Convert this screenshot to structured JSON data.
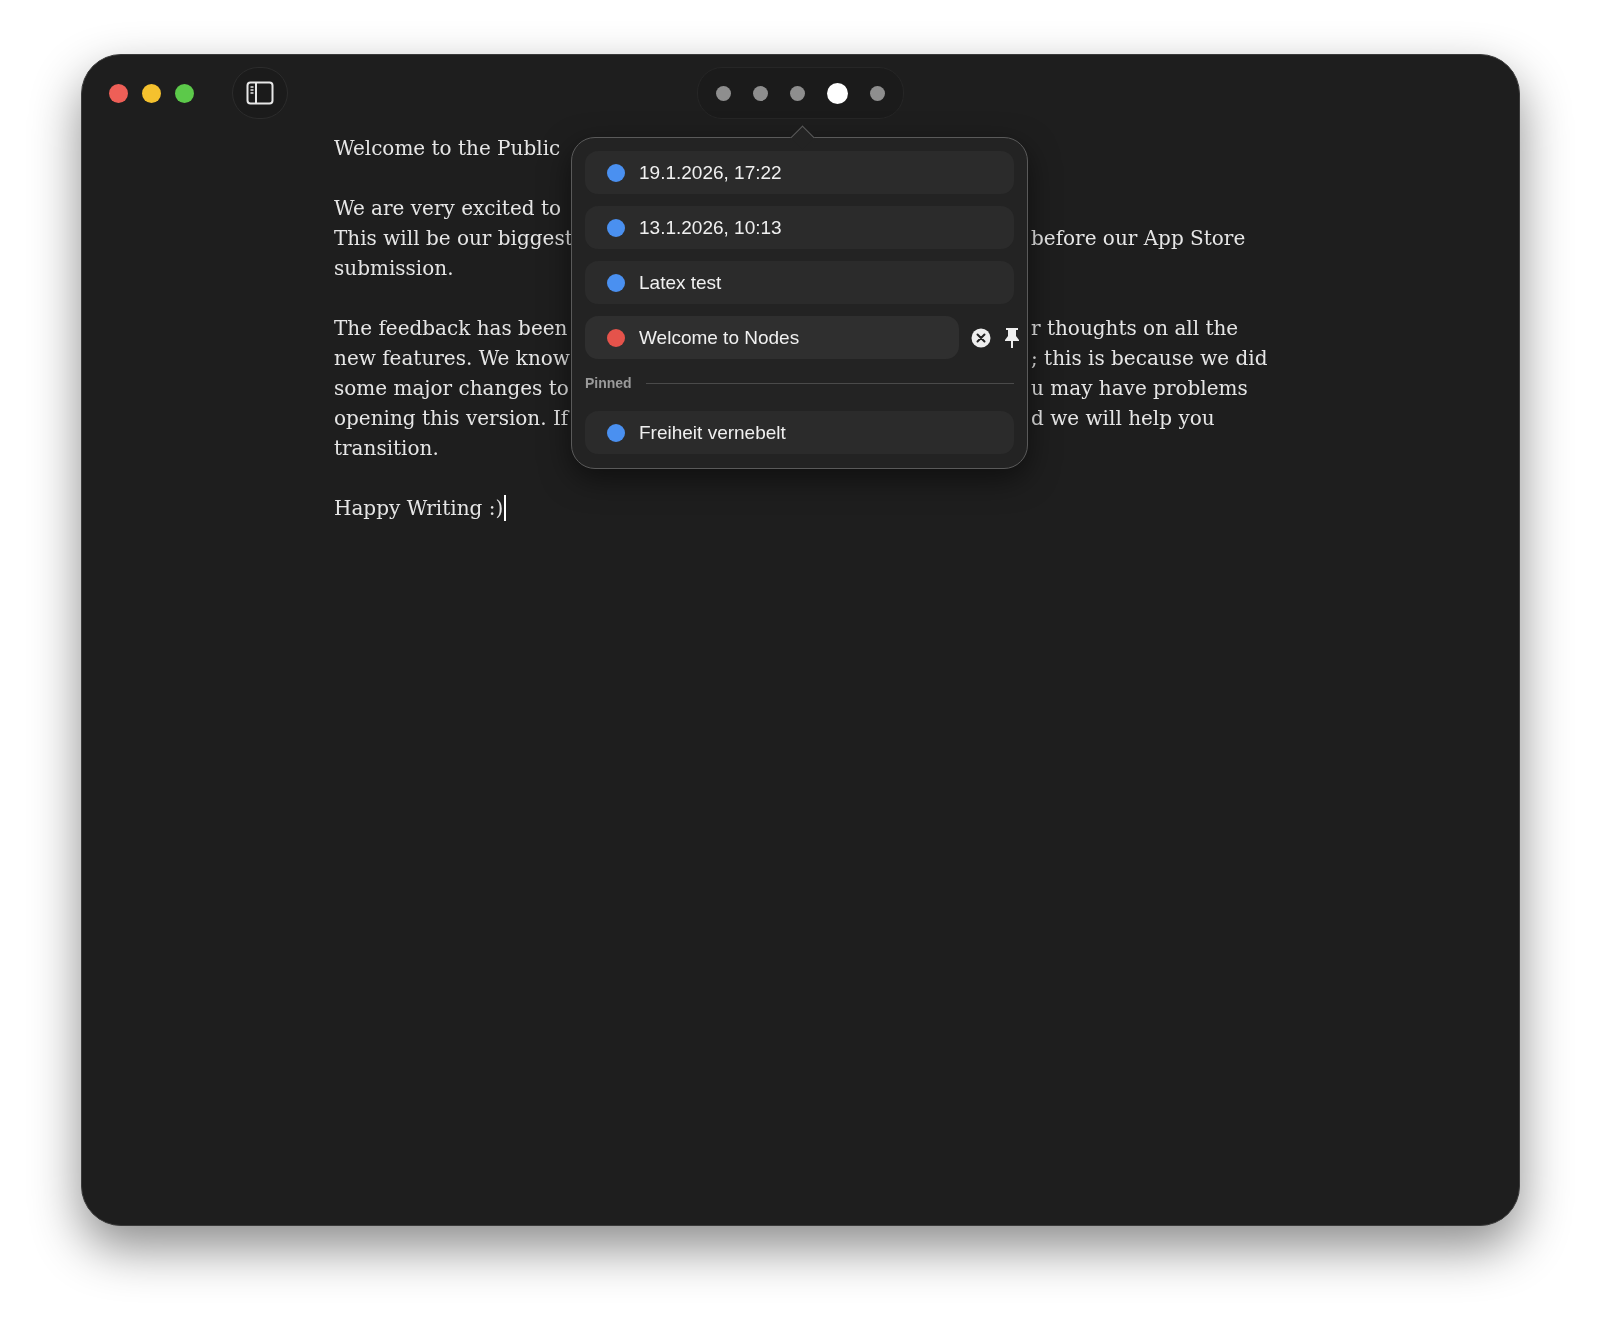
{
  "window": {
    "page_dots": [
      {
        "selected": false
      },
      {
        "selected": false
      },
      {
        "selected": false
      },
      {
        "selected": true
      },
      {
        "selected": false
      }
    ]
  },
  "document": {
    "paragraphs": [
      {
        "lines": [
          {
            "left": "Welcome to the Public"
          }
        ]
      },
      {
        "lines": [
          {
            "left": "We are very excited to"
          },
          {
            "left": "This will be our biggest",
            "right": "before our App Store"
          },
          {
            "left": "submission."
          }
        ]
      },
      {
        "lines": [
          {
            "left": "The feedback has been",
            "right": "r thoughts on all the"
          },
          {
            "left": "new features. We know",
            "right": "; this is because we did"
          },
          {
            "left": "some major changes to",
            "right": "u may have problems"
          },
          {
            "left": "opening this version. If",
            "right": "d we will help you"
          },
          {
            "left": "transition."
          }
        ]
      },
      {
        "lines": [
          {
            "left": "Happy Writing :)",
            "cursor": true
          }
        ]
      }
    ]
  },
  "history_popup": {
    "items": [
      {
        "label": "19.1.2026, 17:22",
        "color": "#4a90f0",
        "hovered": false
      },
      {
        "label": "13.1.2026, 10:13",
        "color": "#4a90f0",
        "hovered": false
      },
      {
        "label": "Latex test",
        "color": "#4a90f0",
        "hovered": false
      },
      {
        "label": "Welcome to Nodes",
        "color": "#e5534b",
        "hovered": true
      }
    ],
    "pinned_label": "Pinned",
    "pinned_items": [
      {
        "label": "Freiheit vernebelt",
        "color": "#4a90f0",
        "hovered": false
      }
    ]
  }
}
